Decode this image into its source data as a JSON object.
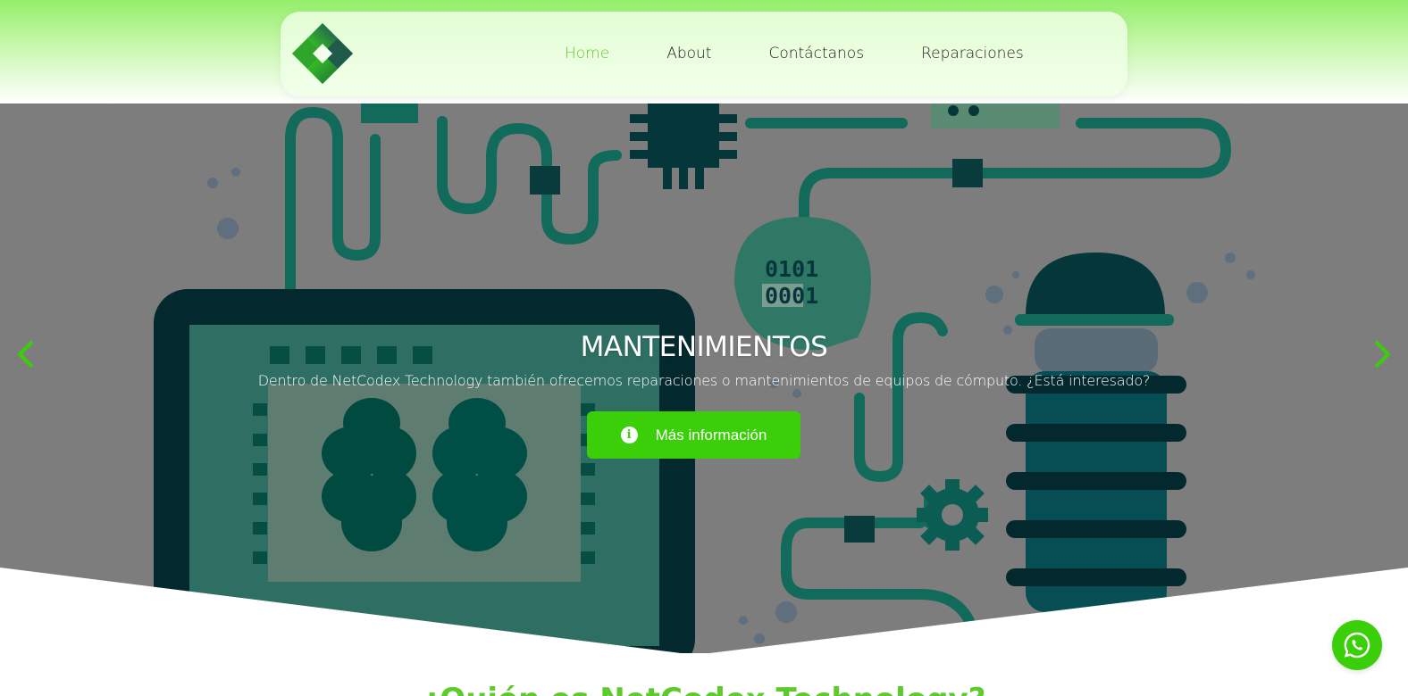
{
  "nav": {
    "items": [
      {
        "label": "Home",
        "active": true
      },
      {
        "label": "About",
        "active": false
      },
      {
        "label": "Contáctanos",
        "active": false
      },
      {
        "label": "Reparaciones",
        "active": false
      }
    ]
  },
  "hero": {
    "title": "MANTENIMIENTOS",
    "description": "Dentro de NetCodex Technology también ofrecemos reparaciones o mantenimientos de equipos de cómputo. ¿Está interesado?",
    "button_label": "Más información",
    "binary_top": "0101",
    "binary_bottom": "0001"
  },
  "section": {
    "heading": "¿Quién es NetCodex Technology?"
  },
  "icons": [
    "logo-icon",
    "info-icon",
    "chevron-left-icon",
    "chevron-right-icon",
    "whatsapp-icon"
  ],
  "colors": {
    "accent": "#3bcf0a",
    "nav_active": "#5dcb2c",
    "header_top": "#93ee6a",
    "hero_overlay": "#7d7d7d"
  }
}
